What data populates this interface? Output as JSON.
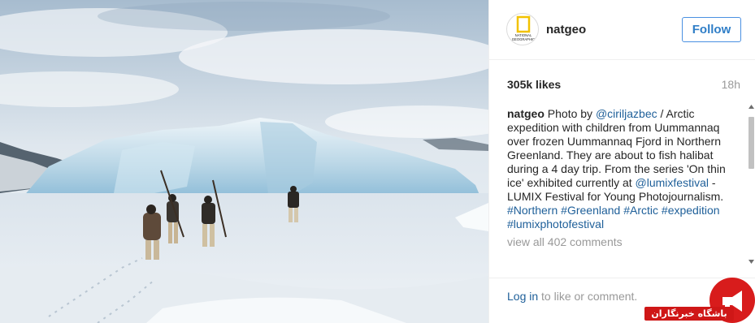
{
  "post": {
    "username": "natgeo",
    "avatar_text": [
      "NATIONAL",
      "GEOGRAPHIC"
    ],
    "follow_label": "Follow",
    "likes": "305k likes",
    "timestamp": "18h",
    "caption": {
      "username": "natgeo",
      "t1": " Photo by ",
      "m1": "@ciriljazbec",
      "t2": " / Arctic expedition with children from Uummannaq over frozen Uummannaq Fjord in Northern Greenland. They are about to fish halibat during a 4 day trip. From the series 'On thin ice' exhibited currently at ",
      "m2": "@lumixfestival",
      "t3": " - LUMIX Festival for Young Photojournalism. ",
      "h1": "#Northern",
      "h2": "#Greenland",
      "h3": "#Arctic",
      "h4": "#expedition",
      "h5": "#lumixphotofestival"
    },
    "view_all": "view all 402 comments",
    "login_link": "Log in",
    "login_rest": " to like or comment."
  },
  "watermark": {
    "text": "باشگاه خبرنگاران",
    "color": "#d81c1c"
  },
  "colors": {
    "link": "#1e5f99",
    "follow_border": "#4a90e2",
    "muted": "#999999"
  }
}
